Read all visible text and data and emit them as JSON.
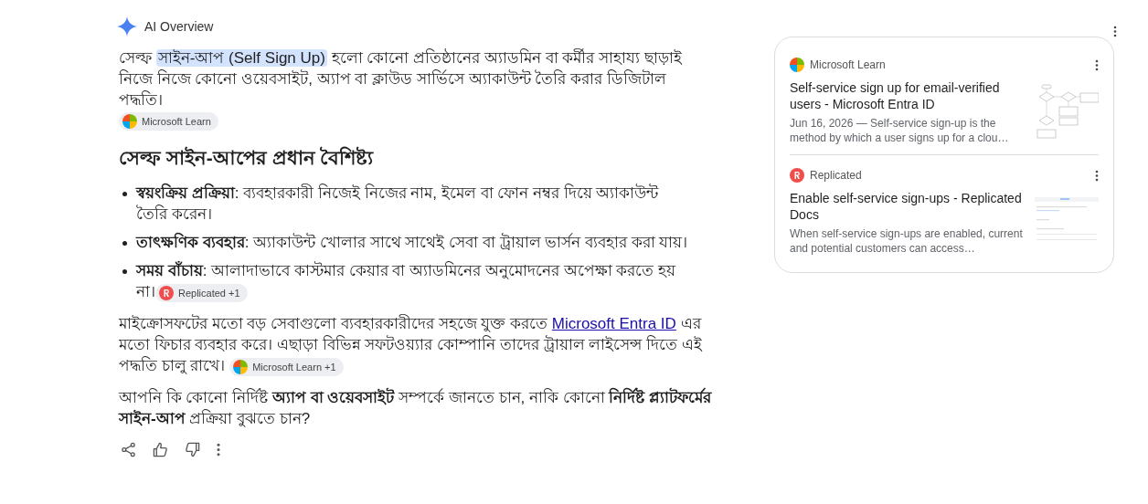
{
  "header": {
    "title": "AI Overview"
  },
  "intro": {
    "segments": [
      {
        "kind": "text",
        "text": "সেল্ফ "
      },
      {
        "kind": "highlight",
        "text": "সাইন-আপ (Self Sign Up)"
      },
      {
        "kind": "text",
        "text": " হলো কোনো প্রতিষ্ঠানের অ্যাডমিন বা কর্মীর সাহায্য ছাড়াই নিজে নিজে কোনো ওয়েবসাইট, অ্যাপ বা ক্লাউড সার্ভিসে অ্যাকাউন্ট তৈরি করার ডিজিটাল পদ্ধতি।"
      }
    ],
    "source": {
      "kind": "microsoft",
      "label": "Microsoft Learn"
    }
  },
  "heading": "সেল্ফ সাইন-আপের প্রধান বৈশিষ্ট্য",
  "bullets": [
    {
      "text": "**স্বয়ংক্রিয় প্রক্রিয়া**: ব্যবহারকারী নিজেই নিজের নাম, ইমেল বা ফোন নম্বর দিয়ে অ্যাকাউন্ট তৈরি করেন।"
    },
    {
      "text": "**তাৎক্ষণিক ব্যবহার**: অ্যাকাউন্ট খোলার সাথে সাথেই সেবা বা ট্রায়াল ভার্সন ব্যবহার করা যায়।"
    },
    {
      "text": "**সময় বাঁচায়**: আলাদাভাবে কাস্টমার কেয়ার বা অ্যাডমিনের অনুমোদনের অপেক্ষা করতে হয় না।",
      "source": {
        "kind": "replicated",
        "label": "Replicated +1"
      }
    }
  ],
  "para": {
    "segments": [
      {
        "kind": "text",
        "text": "মাইক্রোসফটের মতো বড় সেবাগুলো ব্যবহারকারীদের সহজে যুক্ত করতে "
      },
      {
        "kind": "link",
        "text": "Microsoft Entra ID"
      },
      {
        "kind": "text",
        "text": " এর মতো ফিচার ব্যবহার করে। এছাড়া বিভিন্ন সফটওয়্যার কোম্পানি তাদের ট্রায়াল লাইসেন্স দিতে এই পদ্ধতি চালু রাখে।"
      }
    ],
    "source": {
      "kind": "microsoft",
      "label": "Microsoft Learn +1"
    }
  },
  "question": "আপনি কি কোনো নির্দিষ্ট **অ্যাপ বা ওয়েবসাইট** সম্পর্কে জানতে চান, নাকি কোনো **নির্দিষ্ট প্ল্যাটফর্মের সাইন-আপ** প্রক্রিয়া বুঝতে চান?",
  "sources": [
    {
      "kind": "microsoft",
      "site": "Microsoft Learn",
      "title": "Self-service sign up for email-verified users - Microsoft Entra ID",
      "snippet": "Jun 16, 2026 — Self-service sign-up is the method by which a user signs up for a clou…"
    },
    {
      "kind": "replicated",
      "site": "Replicated",
      "title": "Enable self-service sign-ups - Replicated Docs",
      "snippet": "When self-service sign-ups are enabled, current and potential customers can access…"
    }
  ]
}
